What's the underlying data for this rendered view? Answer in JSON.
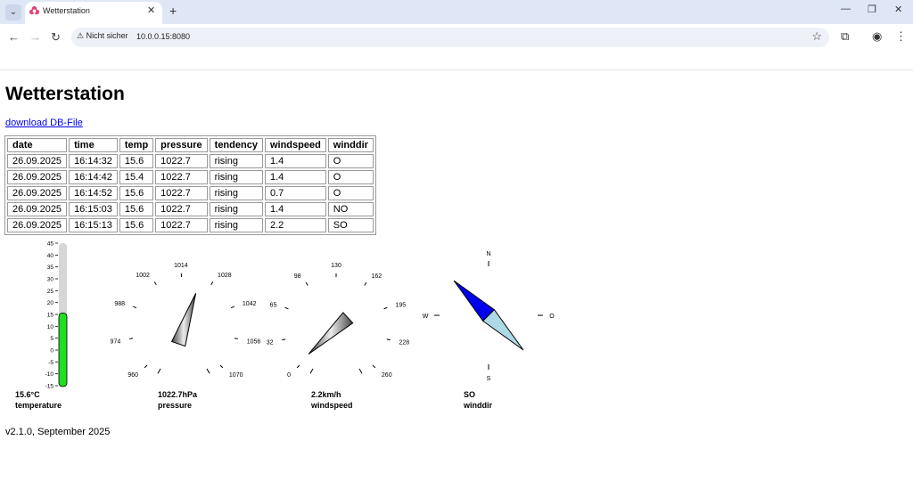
{
  "browser": {
    "tab_title": "Wetterstation",
    "security_label": "Nicht sicher",
    "url": "10.0.0.15:8080"
  },
  "page": {
    "title": "Wetterstation",
    "download_link": "download DB-File",
    "footer": "v2.1.0, September 2025"
  },
  "table": {
    "headers": [
      "date",
      "time",
      "temp",
      "pressure",
      "tendency",
      "windspeed",
      "winddir"
    ],
    "rows": [
      [
        "26.09.2025",
        "16:14:32",
        "15.6",
        "1022.7",
        "rising",
        "1.4",
        "O"
      ],
      [
        "26.09.2025",
        "16:14:42",
        "15.4",
        "1022.7",
        "rising",
        "1.4",
        "O"
      ],
      [
        "26.09.2025",
        "16:14:52",
        "15.6",
        "1022.7",
        "rising",
        "0.7",
        "O"
      ],
      [
        "26.09.2025",
        "16:15:03",
        "15.6",
        "1022.7",
        "rising",
        "1.4",
        "NO"
      ],
      [
        "26.09.2025",
        "16:15:13",
        "15.6",
        "1022.7",
        "rising",
        "2.2",
        "SO"
      ]
    ]
  },
  "thermometer": {
    "value": 15.6,
    "min": -15,
    "max": 45,
    "ticks": [
      "45",
      "40",
      "35",
      "30",
      "25",
      "20",
      "15",
      "10",
      "5",
      "0",
      "-5",
      "-10",
      "-15"
    ],
    "value_text": "15.6°C",
    "label": "temperature",
    "fill_color": "#22dd22"
  },
  "pressure_gauge": {
    "value": 1022.7,
    "min": 960,
    "max": 1070,
    "ticks": [
      "960",
      "974",
      "988",
      "1002",
      "1014",
      "1028",
      "1042",
      "1056",
      "1070"
    ],
    "value_text": "1022.7hPa",
    "label": "pressure"
  },
  "wind_gauge": {
    "value": 2.2,
    "min": 0,
    "max": 260,
    "ticks": [
      "0",
      "32",
      "65",
      "98",
      "130",
      "162",
      "195",
      "228",
      "260"
    ],
    "value_text": "2.2km/h",
    "label": "windspeed"
  },
  "compass": {
    "directions": [
      "N",
      "O",
      "S",
      "W"
    ],
    "value_text": "SO",
    "label": "winddir",
    "north_color": "#0000ee",
    "south_color": "#add8e6"
  }
}
